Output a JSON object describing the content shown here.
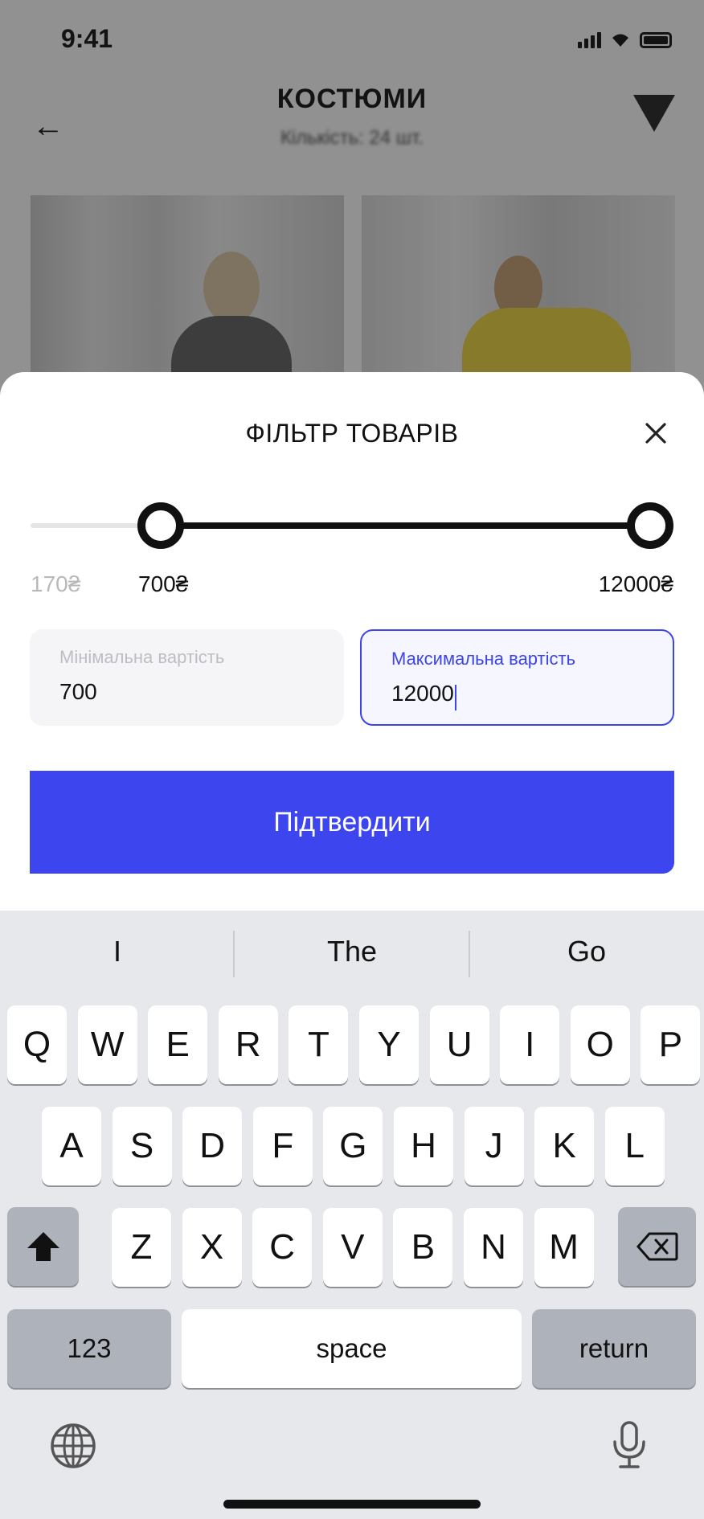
{
  "background_screen": {
    "status_time": "9:41",
    "title": "КОСТЮМИ",
    "subtitle": "Кількість: 24 шт."
  },
  "sheet": {
    "title": "ФІЛЬТР ТОВАРІВ",
    "slider": {
      "range_min_label": "170₴",
      "selected_min_label": "700₴",
      "selected_max_label": "12000₴",
      "range_min": 170,
      "range_max": 12000,
      "selected_min": 700,
      "selected_max": 12000
    },
    "min_field": {
      "label": "Мінімальна вартість",
      "value": "700"
    },
    "max_field": {
      "label": "Максимальна вартість",
      "value": "12000"
    },
    "confirm_label": "Підтвердити",
    "accent_color": "#3d45ee"
  },
  "keyboard": {
    "suggestions": [
      "I",
      "The",
      "Go"
    ],
    "row1": [
      "Q",
      "W",
      "E",
      "R",
      "T",
      "Y",
      "U",
      "I",
      "O",
      "P"
    ],
    "row2": [
      "A",
      "S",
      "D",
      "F",
      "G",
      "H",
      "J",
      "K",
      "L"
    ],
    "row3": [
      "Z",
      "X",
      "C",
      "V",
      "B",
      "N",
      "M"
    ],
    "numbers_label": "123",
    "space_label": "space",
    "return_label": "return",
    "icons": [
      "shift-icon",
      "backspace-icon",
      "globe-icon",
      "microphone-icon"
    ]
  }
}
